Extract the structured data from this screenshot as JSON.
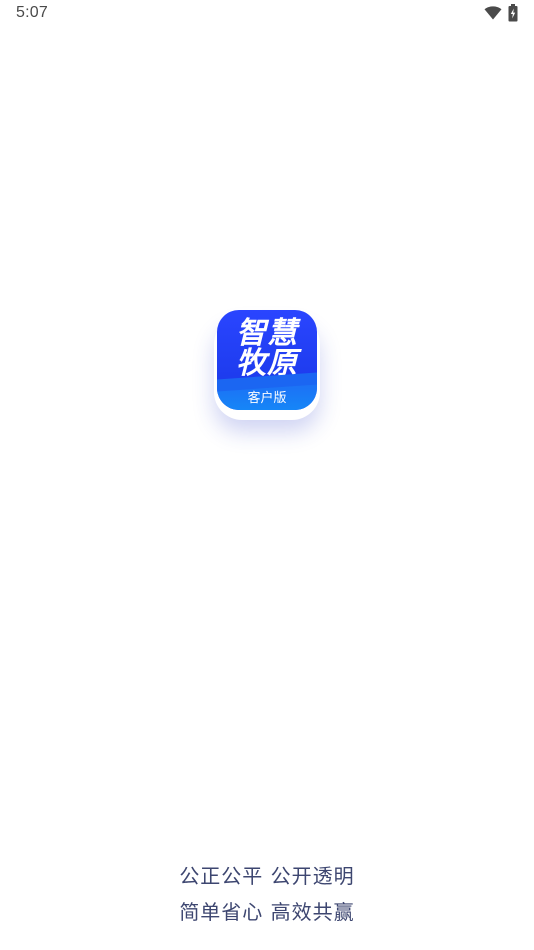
{
  "status_bar": {
    "time": "5:07",
    "icons": [
      "wifi-icon",
      "battery-charging-icon"
    ]
  },
  "logo": {
    "line1": "智慧",
    "line2": "牧原",
    "subtitle": "客户版",
    "colors": {
      "primary": "#2a45ff",
      "band": "#1686f7"
    }
  },
  "slogan": {
    "line1": "公正公平 公开透明",
    "line2": "简单省心 高效共赢"
  }
}
